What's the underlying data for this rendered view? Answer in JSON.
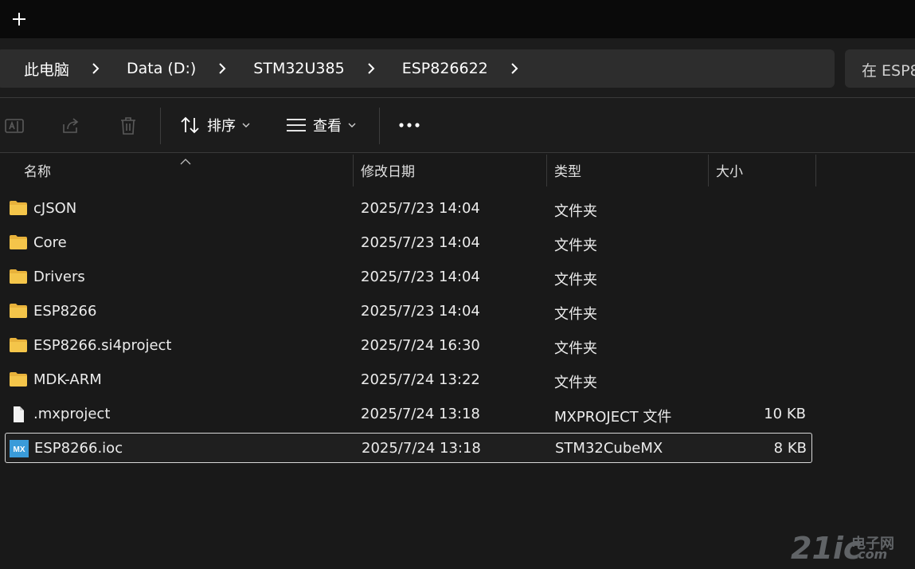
{
  "breadcrumb": [
    "此电脑",
    "Data (D:)",
    "STM32U385",
    "ESP826622"
  ],
  "search": {
    "placeholder": "在 ESP8"
  },
  "toolbar": {
    "sort_label": "排序",
    "view_label": "查看"
  },
  "columns": {
    "name": "名称",
    "date": "修改日期",
    "type": "类型",
    "size": "大小"
  },
  "files": [
    {
      "name": "cJSON",
      "date": "2025/7/23 14:04",
      "type": "文件夹",
      "size": "",
      "icon": "folder-icon"
    },
    {
      "name": "Core",
      "date": "2025/7/23 14:04",
      "type": "文件夹",
      "size": "",
      "icon": "folder-icon"
    },
    {
      "name": "Drivers",
      "date": "2025/7/23 14:04",
      "type": "文件夹",
      "size": "",
      "icon": "folder-icon"
    },
    {
      "name": "ESP8266",
      "date": "2025/7/23 14:04",
      "type": "文件夹",
      "size": "",
      "icon": "folder-icon"
    },
    {
      "name": "ESP8266.si4project",
      "date": "2025/7/24 16:30",
      "type": "文件夹",
      "size": "",
      "icon": "folder-icon"
    },
    {
      "name": "MDK-ARM",
      "date": "2025/7/24 13:22",
      "type": "文件夹",
      "size": "",
      "icon": "folder-icon"
    },
    {
      "name": ".mxproject",
      "date": "2025/7/24 13:18",
      "type": "MXPROJECT 文件",
      "size": "10 KB",
      "icon": "file-icon"
    },
    {
      "name": "ESP8266.ioc",
      "date": "2025/7/24 13:18",
      "type": "STM32CubeMX",
      "size": "8 KB",
      "icon": "mx-icon"
    }
  ],
  "mx_icon_text": "MX",
  "watermark": {
    "number": "21ic",
    "cn": "电子网",
    "com": ".com"
  },
  "colors": {
    "folder": "#f4c54a",
    "accent": "#60cdff",
    "selection_border": "#d8d8d8"
  }
}
